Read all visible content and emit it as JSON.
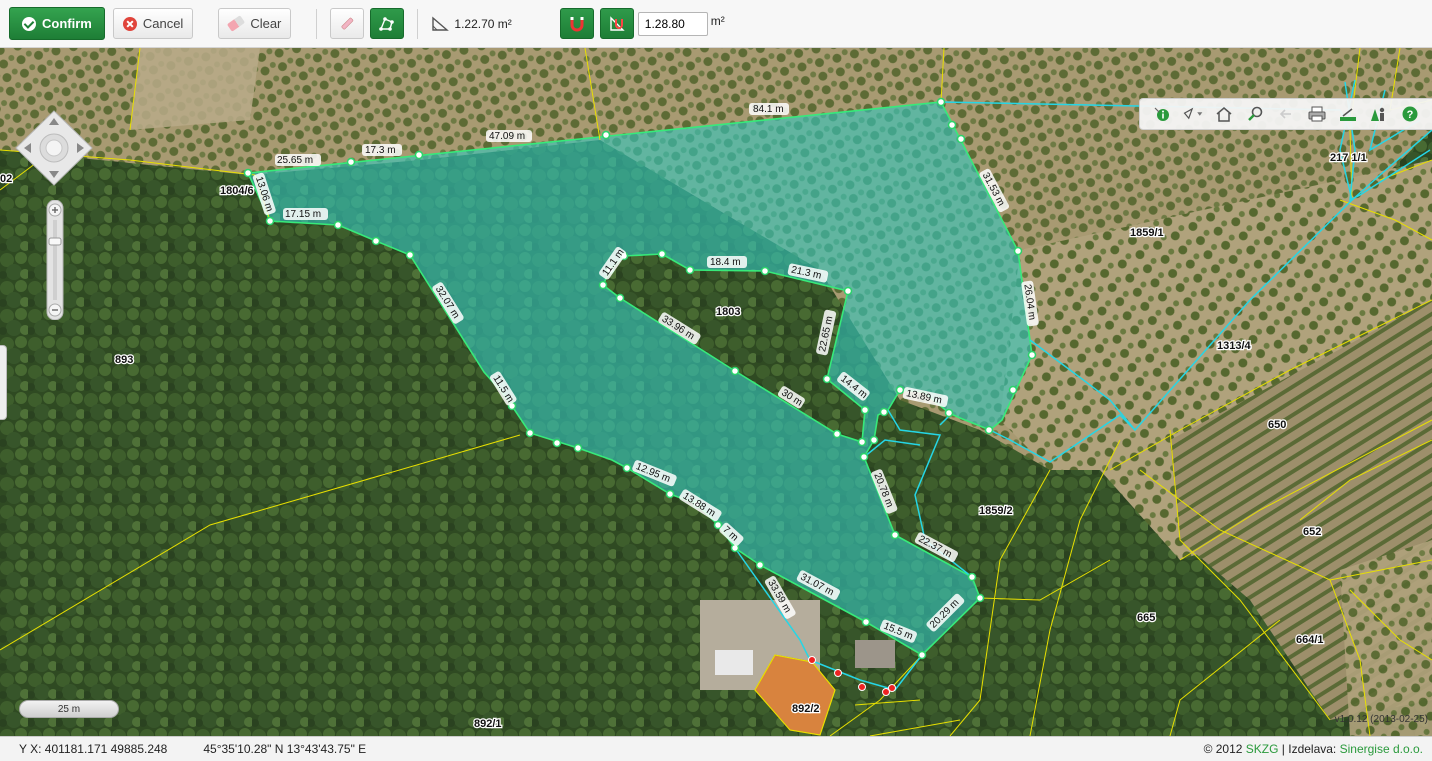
{
  "toolbar": {
    "confirm_label": "Confirm",
    "cancel_label": "Cancel",
    "clear_label": "Clear",
    "area_text": "1.22.70 m²",
    "area_input_value": "1.28.80",
    "area_unit": "m²"
  },
  "map": {
    "parcels": [
      "1804/6",
      "02",
      "893",
      "1803",
      "1859/1",
      "217 1/1",
      "1313/4",
      "650",
      "652",
      "1859/2",
      "665",
      "664/1",
      "892/1",
      "892/2"
    ],
    "measurements": [
      "84.1 m",
      "47.09 m",
      "17.3 m",
      "25.65 m",
      "13.06 m",
      "17.15 m",
      "32.07 m",
      "11.5 m",
      "12.95 m",
      "13.88 m",
      "7 m",
      "33.59 m",
      "31.07 m",
      "15.5 m",
      "20.29 m",
      "22.37 m",
      "20.78 m",
      "13.89 m",
      "14.4 m",
      "30 m",
      "33.96 m",
      "11.1 m",
      "18.4 m",
      "21.3 m",
      "22.65 m",
      "31.53 m",
      "26.04 m"
    ],
    "scale_label": "25 m",
    "version": "v1.0.12 (2013-02-25)"
  },
  "status": {
    "yx": "Y X: 401181.171 49885.248",
    "latlon": "45°35'10.28\" N 13°43'43.75\" E",
    "credit_prefix": "© 2012 ",
    "credit_link1": "SKZG",
    "credit_middle": " | Izdelava: ",
    "credit_link2": "Sinergise d.o.o."
  },
  "colors": {
    "polygon_fill": "#35c6bd",
    "polygon_edge": "#37ea7a",
    "parcel_line": "#e8e000",
    "neighbor_line": "#25d6e6",
    "accent": "#1e7e36"
  }
}
